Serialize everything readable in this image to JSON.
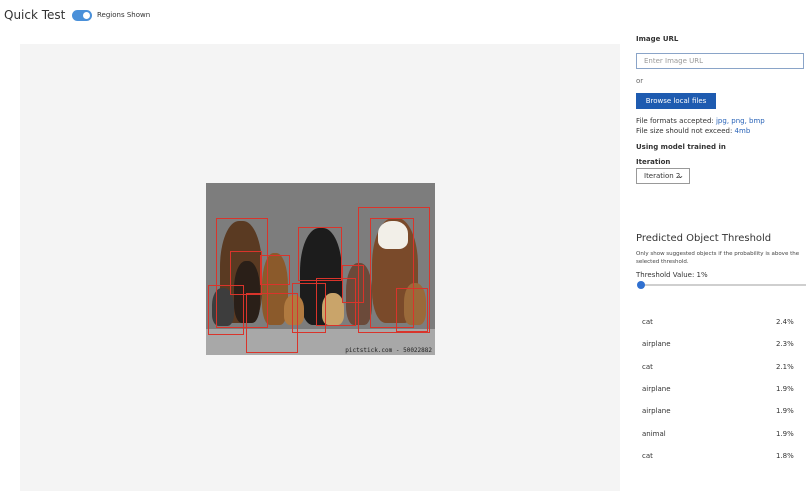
{
  "header": {
    "title": "Quick Test",
    "toggle_label": "Regions Shown",
    "toggle_on": true
  },
  "image": {
    "watermark": "pictstick.com - 50022882"
  },
  "panel": {
    "image_url_label": "Image URL",
    "image_url_placeholder": "Enter Image URL",
    "image_url_value": "",
    "or_label": "or",
    "browse_label": "Browse local files",
    "formats_prefix": "File formats accepted: ",
    "formats": "jpg, png, bmp",
    "size_prefix": "File size should not exceed: ",
    "size_value": "4mb",
    "model_label": "Using model trained in",
    "iteration_label": "Iteration",
    "iteration_value": "Iteration 2",
    "threshold_title": "Predicted Object Threshold",
    "threshold_desc": "Only show suggested objects if the probability is above the selected threshold.",
    "threshold_value_label": "Threshold Value: 1%",
    "threshold_value": 1
  },
  "predictions": [
    {
      "tag": "cat",
      "prob": "2.4%"
    },
    {
      "tag": "airplane",
      "prob": "2.3%"
    },
    {
      "tag": "cat",
      "prob": "2.1%"
    },
    {
      "tag": "airplane",
      "prob": "1.9%"
    },
    {
      "tag": "airplane",
      "prob": "1.9%"
    },
    {
      "tag": "animal",
      "prob": "1.9%"
    },
    {
      "tag": "cat",
      "prob": "1.8%"
    }
  ],
  "colors": {
    "accent": "#1e5bb0",
    "toggle": "#4a90d9",
    "region": "#d9342b"
  }
}
